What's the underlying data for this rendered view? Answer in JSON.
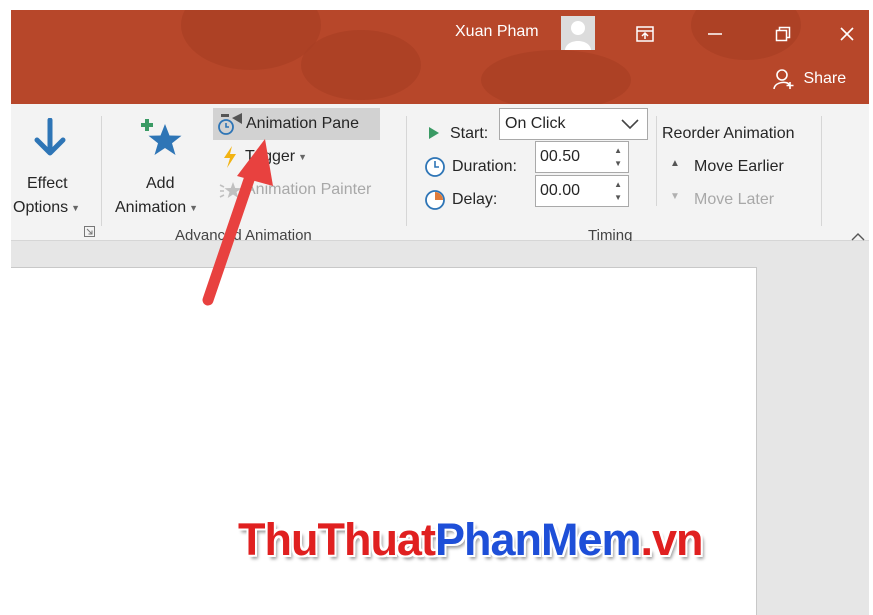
{
  "titlebar": {
    "user_name": "Xuan Pham",
    "share_label": "Share",
    "buttons": [
      "ribbon-display-icon",
      "minimize-icon",
      "restore-icon",
      "close-icon"
    ]
  },
  "ribbon": {
    "effect_options": {
      "line1": "Effect",
      "line2": "Options"
    },
    "add_animation": {
      "line1": "Add",
      "line2": "Animation"
    },
    "animation_pane": "Animation Pane",
    "trigger": "Trigger",
    "animation_painter": "Animation Painter",
    "advanced_group_label": "Advanced Animation",
    "start_label": "Start:",
    "start_value": "On Click",
    "duration_label": "Duration:",
    "duration_value": "00.50",
    "delay_label": "Delay:",
    "delay_value": "00.00",
    "timing_group_label": "Timing",
    "reorder_title": "Reorder Animation",
    "move_earlier": "Move Earlier",
    "move_later": "Move Later"
  },
  "watermark": {
    "part1": "ThuThuat",
    "part2": "PhanMem",
    "part3": ".vn"
  },
  "colors": {
    "titlebar": "#b7472a",
    "ribbon_bg": "#f3f3f3",
    "accent_arrow": "#e8413f",
    "icon_blue": "#2e75b6"
  }
}
